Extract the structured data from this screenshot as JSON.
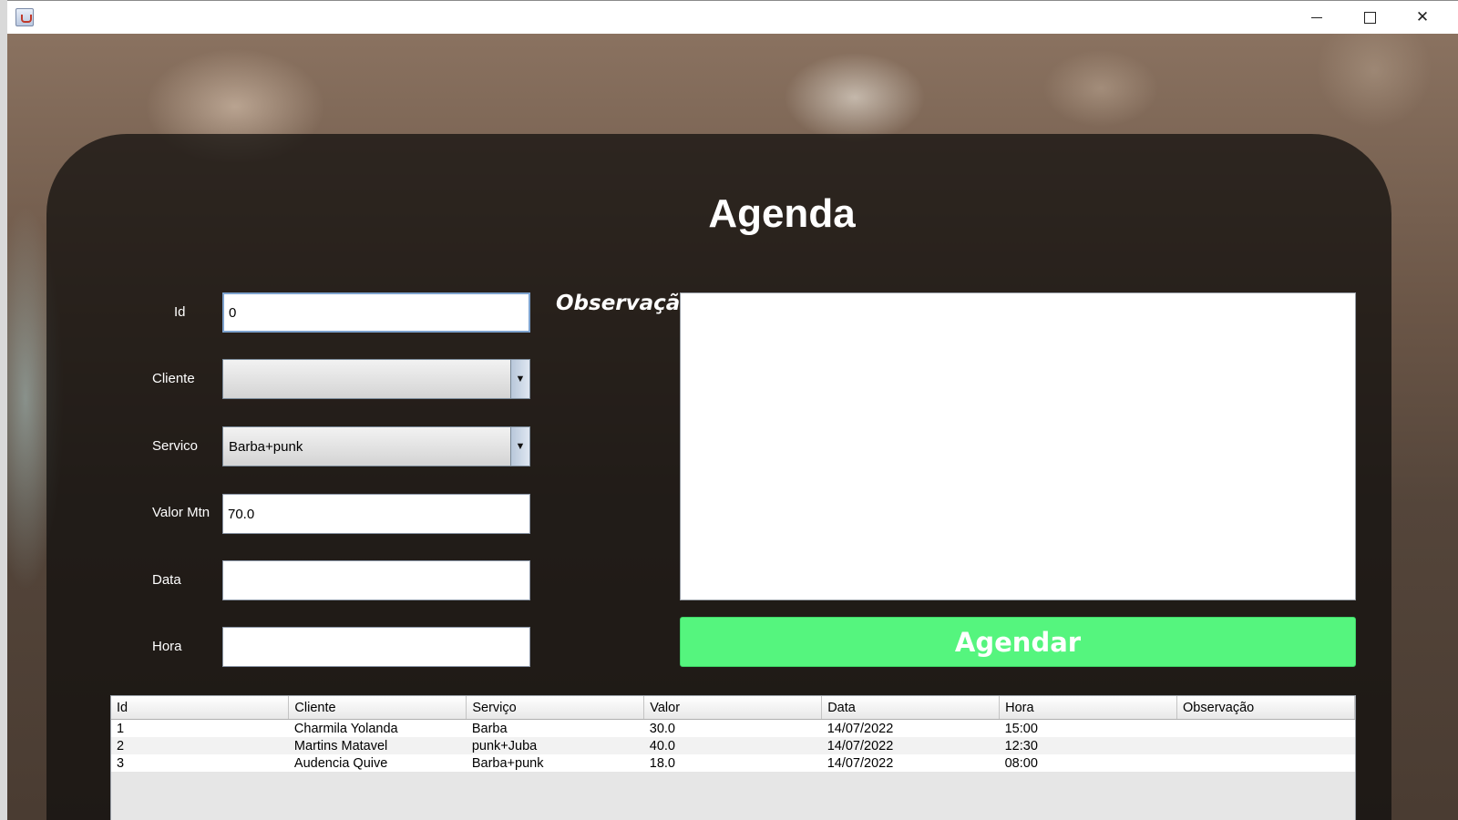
{
  "window": {
    "minimize_glyph": "",
    "maximize_glyph": "",
    "close_glyph": "✕"
  },
  "form": {
    "title": "Agenda",
    "id_label": "Id",
    "id_value": "0",
    "cliente_label": "Cliente",
    "cliente_value": "",
    "servico_label": "Servico",
    "servico_value": "Barba+punk",
    "valor_label": "Valor Mtn",
    "valor_value": "70.0",
    "data_label": "Data",
    "data_value": "",
    "hora_label": "Hora",
    "hora_value": "",
    "obs_label": "Observação",
    "obs_value": "",
    "dropdown_glyph": "▼",
    "submit_label": "Agendar"
  },
  "colors": {
    "submit_bg": "#55f57e",
    "panel_bg": "rgba(14,12,11,0.72)"
  },
  "table": {
    "headers": [
      "Id",
      "Cliente",
      "Serviço",
      "Valor",
      "Data",
      "Hora",
      "Observação"
    ],
    "rows": [
      [
        "1",
        "Charmila Yolanda",
        "Barba",
        "30.0",
        "14/07/2022",
        "15:00",
        ""
      ],
      [
        "2",
        "Martins Matavel",
        "punk+Juba",
        "40.0",
        "14/07/2022",
        "12:30",
        ""
      ],
      [
        "3",
        "Audencia Quive",
        "Barba+punk",
        "18.0",
        "14/07/2022",
        "08:00",
        ""
      ]
    ]
  }
}
